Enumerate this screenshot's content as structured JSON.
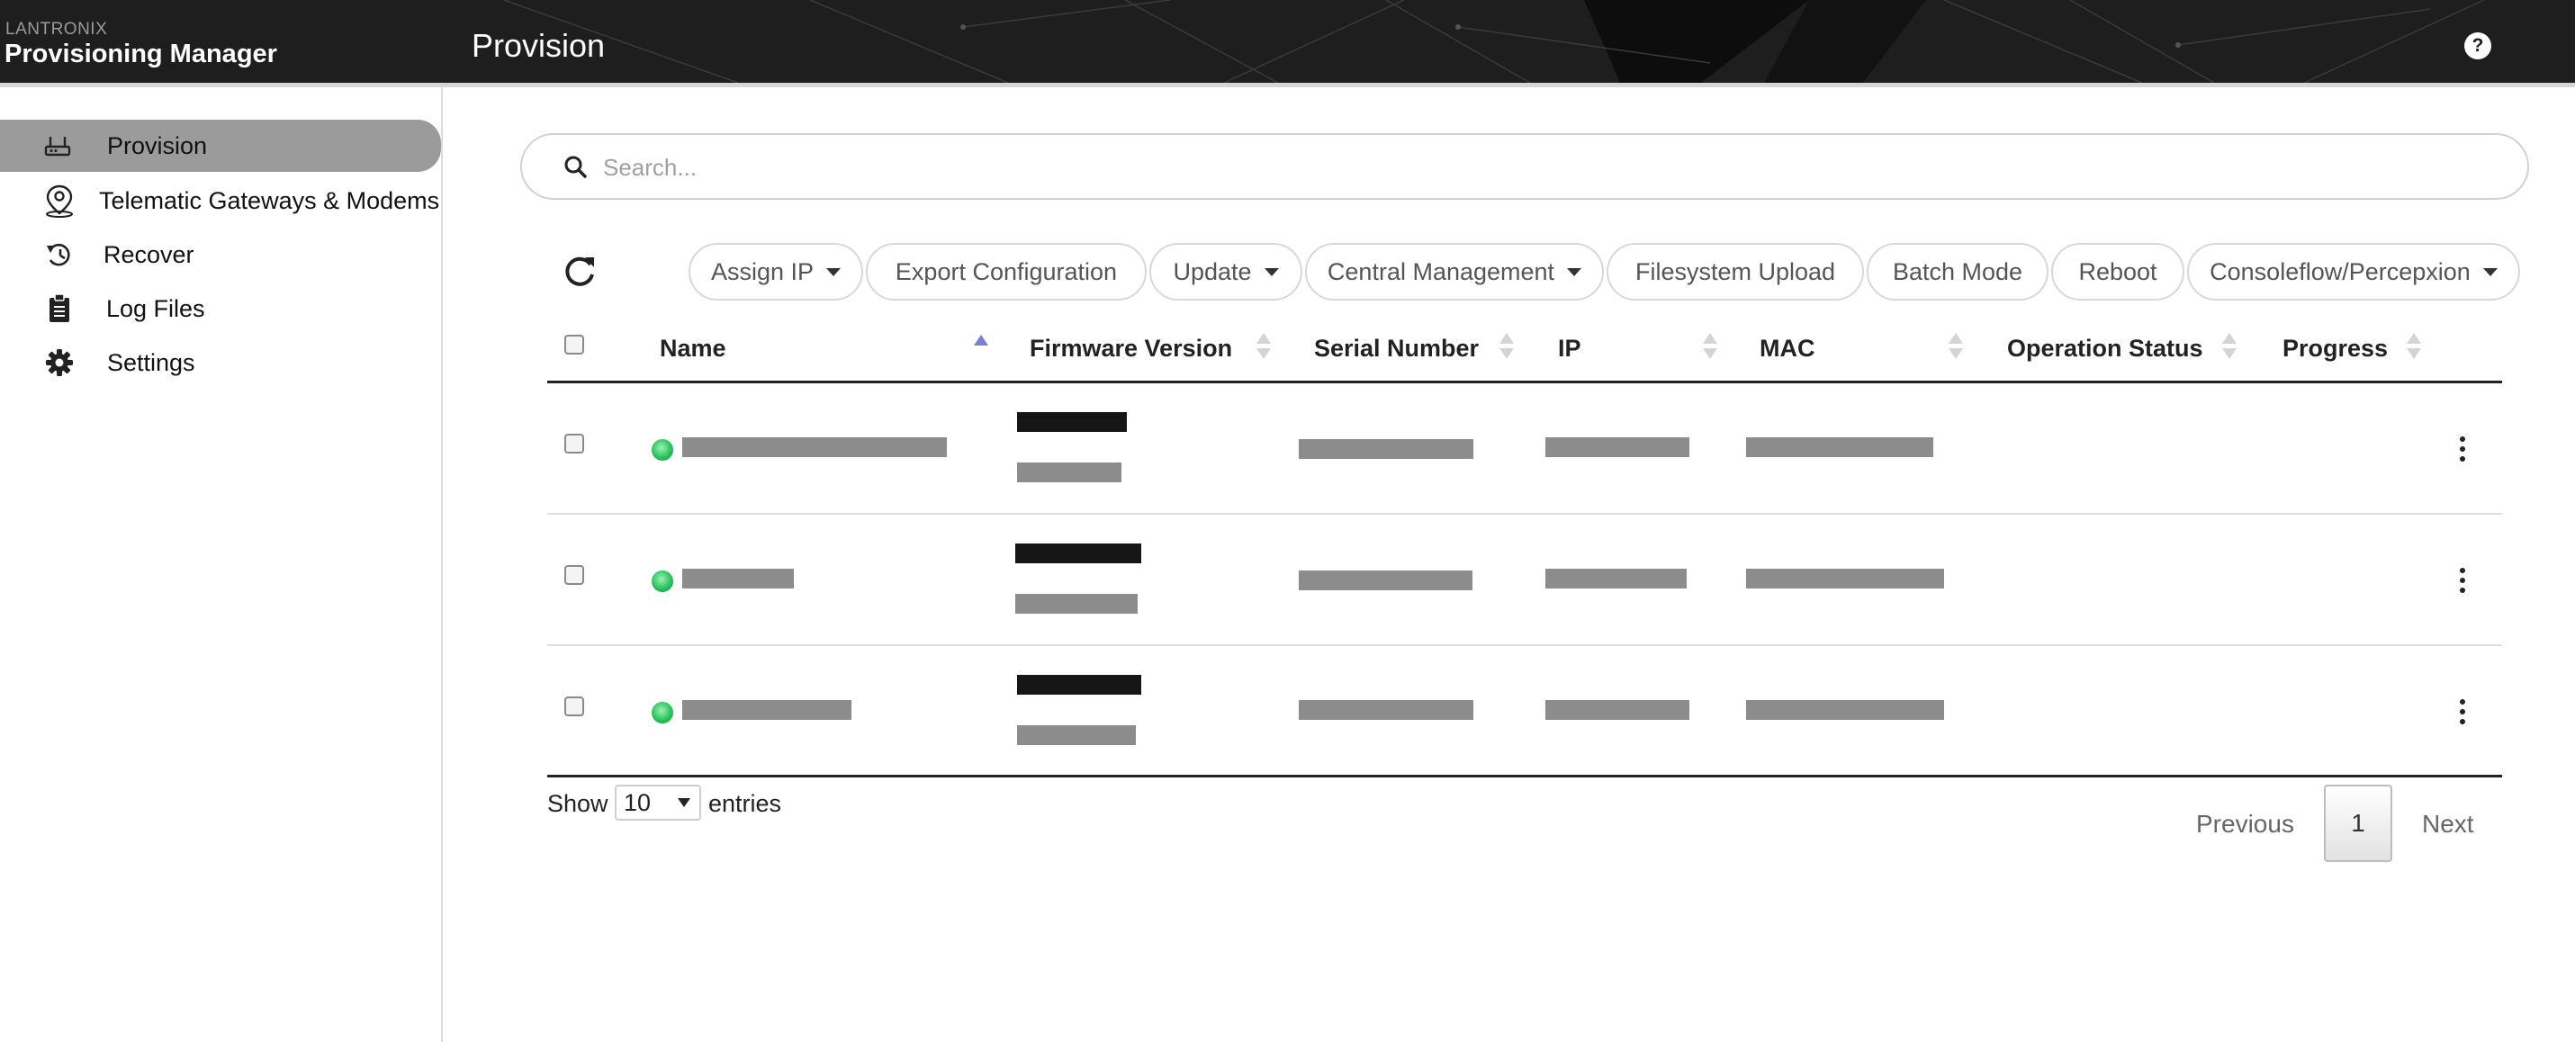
{
  "header": {
    "brand_small": "LANTRONIX",
    "brand_main": "Provisioning Manager",
    "page_title": "Provision",
    "help_label": "?"
  },
  "sidebar": {
    "items": [
      {
        "label": "Provision",
        "icon": "router-icon",
        "active": true
      },
      {
        "label": "Telematic Gateways & Modems",
        "icon": "map-pin-icon",
        "active": false
      },
      {
        "label": "Recover",
        "icon": "history-icon",
        "active": false
      },
      {
        "label": "Log Files",
        "icon": "clipboard-icon",
        "active": false
      },
      {
        "label": "Settings",
        "icon": "gear-icon",
        "active": false
      }
    ]
  },
  "search": {
    "placeholder": "Search...",
    "value": ""
  },
  "toolbar": {
    "buttons": [
      {
        "label": "Assign IP",
        "dropdown": true
      },
      {
        "label": "Export Configuration",
        "dropdown": false
      },
      {
        "label": "Update",
        "dropdown": true
      },
      {
        "label": "Central Management",
        "dropdown": true
      },
      {
        "label": "Filesystem Upload",
        "dropdown": false
      },
      {
        "label": "Batch Mode",
        "dropdown": false
      },
      {
        "label": "Reboot",
        "dropdown": false
      },
      {
        "label": "Consoleflow/Percepxion",
        "dropdown": true
      }
    ]
  },
  "table": {
    "columns": [
      "Name",
      "Firmware Version",
      "Serial Number",
      "IP",
      "MAC",
      "Operation Status",
      "Progress"
    ],
    "sorted_column": "Name",
    "sort_direction": "ascending",
    "rows": [
      {
        "status": "online",
        "name": "",
        "firmware": "",
        "serial": "",
        "ip": "",
        "mac": "",
        "operation_status": "",
        "progress": ""
      },
      {
        "status": "online",
        "name": "",
        "firmware": "",
        "serial": "",
        "ip": "",
        "mac": "",
        "operation_status": "",
        "progress": ""
      },
      {
        "status": "online",
        "name": "",
        "firmware": "",
        "serial": "",
        "ip": "",
        "mac": "",
        "operation_status": "",
        "progress": ""
      }
    ],
    "redacted_cells": true
  },
  "footer": {
    "show_label": "Show",
    "page_length": "10",
    "entries_label": "entries",
    "previous_label": "Previous",
    "current_page": "1",
    "next_label": "Next"
  },
  "colors": {
    "header_bg": "#1e1e1e",
    "active_nav_bg": "#9b9b9b",
    "status_online": "#27c45a",
    "sort_active": "#7b7fd4",
    "redaction_light": "#8c8c8c",
    "redaction_dark": "#161616"
  }
}
